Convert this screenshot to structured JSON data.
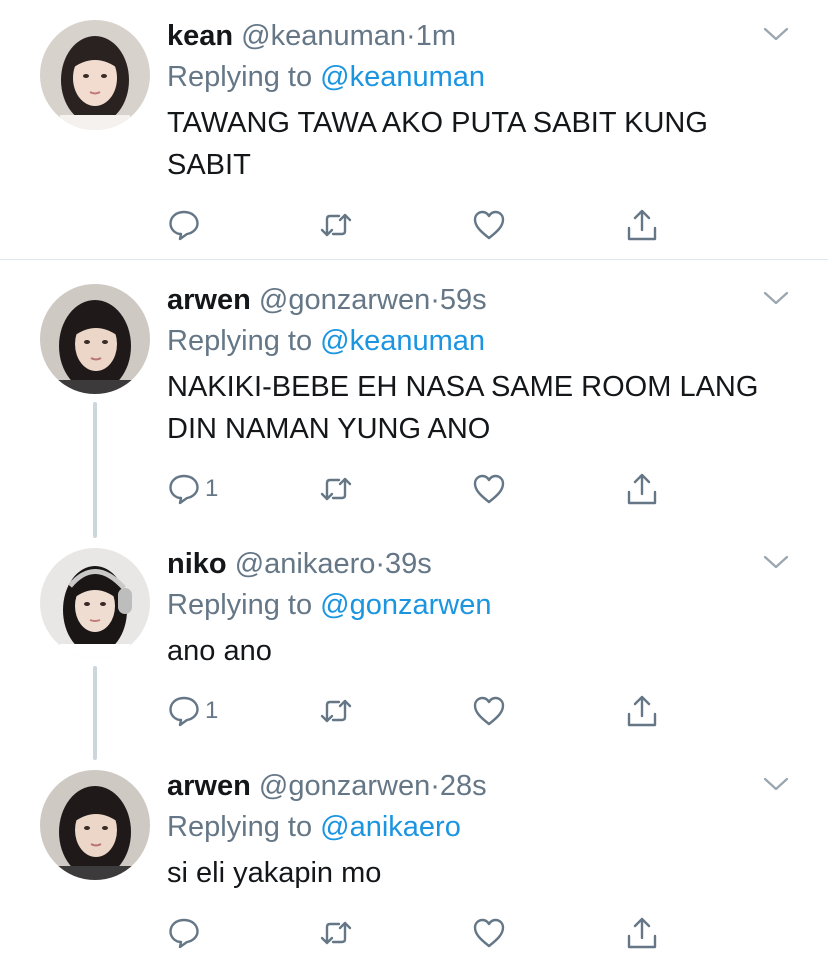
{
  "tweets": [
    {
      "name": "kean",
      "handle": "@keanuman",
      "time": "1m",
      "replying_prefix": "Replying to ",
      "replying_to": "@keanuman",
      "text": "TAWANG TAWA AKO PUTA SABIT KUNG SABIT",
      "reply_count": ""
    },
    {
      "name": "arwen",
      "handle": "@gonzarwen",
      "time": "59s",
      "replying_prefix": "Replying to ",
      "replying_to": "@keanuman",
      "text": "NAKIKI-BEBE EH NASA SAME ROOM LANG DIN NAMAN YUNG ANO",
      "reply_count": "1"
    },
    {
      "name": "niko",
      "handle": "@anikaero",
      "time": "39s",
      "replying_prefix": "Replying to ",
      "replying_to": "@gonzarwen",
      "text": "ano ano",
      "reply_count": "1"
    },
    {
      "name": "arwen",
      "handle": "@gonzarwen",
      "time": "28s",
      "replying_prefix": "Replying to ",
      "replying_to": "@anikaero",
      "text": "si eli yakapin mo",
      "reply_count": ""
    }
  ],
  "separator": "·",
  "colors": {
    "link": "#1b95e0",
    "secondary": "#657786",
    "divider": "#e1e8ed",
    "thread": "#ccd6dd"
  },
  "icons": [
    "reply-icon",
    "retweet-icon",
    "like-icon",
    "share-icon",
    "chevron-down-icon"
  ]
}
